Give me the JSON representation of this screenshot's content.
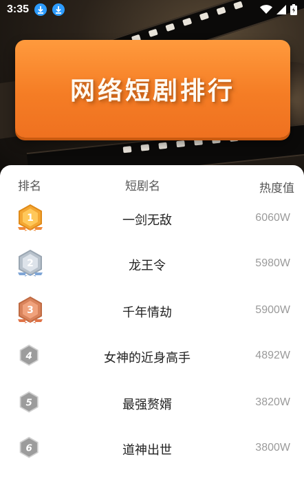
{
  "status_bar": {
    "time": "3:35",
    "notification_icons": [
      "download-icon",
      "download-icon"
    ],
    "right_icons": [
      "wifi-icon",
      "signal-icon",
      "battery-icon"
    ]
  },
  "banner": {
    "title": "网络短剧排行",
    "color": "#f57d25"
  },
  "table": {
    "headers": {
      "rank": "排名",
      "name": "短剧名",
      "heat": "热度值"
    },
    "rows": [
      {
        "rank": "1",
        "badge": "gold-medal-icon",
        "name": "一剑无敌",
        "heat": "6060W"
      },
      {
        "rank": "2",
        "badge": "silver-medal-icon",
        "name": "龙王令",
        "heat": "5980W"
      },
      {
        "rank": "3",
        "badge": "bronze-medal-icon",
        "name": "千年情劫",
        "heat": "5900W"
      },
      {
        "rank": "4",
        "badge": "hexagon-rank-icon",
        "name": "女神的近身高手",
        "heat": "4892W"
      },
      {
        "rank": "5",
        "badge": "hexagon-rank-icon",
        "name": "最强赘婿",
        "heat": "3820W"
      },
      {
        "rank": "6",
        "badge": "hexagon-rank-icon",
        "name": "道神出世",
        "heat": "3800W"
      }
    ]
  }
}
